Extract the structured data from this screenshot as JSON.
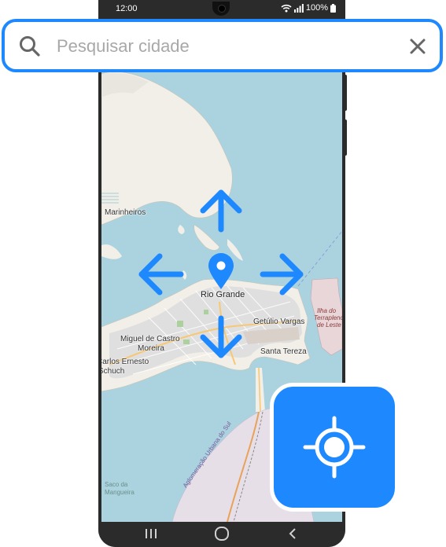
{
  "status_bar": {
    "time": "12:00",
    "battery": "100%"
  },
  "search": {
    "placeholder": "Pesquisar cidade",
    "value": ""
  },
  "map": {
    "labels": {
      "marinheiros": "Marinheiros",
      "rio_grande": "Rio Grande",
      "getulio_vargas": "Getúlio Vargas",
      "miguel_de_castro_moreira_1": "Miguel de Castro",
      "miguel_de_castro_moreira_2": "Moreira",
      "carlos_ernesto_1": "Carlos Ernesto",
      "carlos_ernesto_2": "Schuch",
      "santa_tereza": "Santa Tereza",
      "ilha_terrapleno_1": "Ilha do",
      "ilha_terrapleno_2": "Terrapleno",
      "ilha_terrapleno_3": "de Leste",
      "aglomeracao": "Aglomeração Urbana do Sul",
      "saco_1": "Saco da",
      "saco_2": "Mangueira"
    }
  },
  "colors": {
    "accent": "#1e88ff",
    "water": "#aad3df",
    "land": "#f2efe9",
    "urban": "#e0dfdf",
    "phone_frame": "#2b2b2b"
  },
  "icons": {
    "search": "search-icon",
    "clear": "close-icon",
    "locate": "crosshair-icon",
    "pin": "map-pin-icon",
    "arrows": [
      "arrow-up-icon",
      "arrow-down-icon",
      "arrow-left-icon",
      "arrow-right-icon"
    ],
    "nav": [
      "recent-apps-icon",
      "home-icon",
      "back-icon"
    ]
  }
}
